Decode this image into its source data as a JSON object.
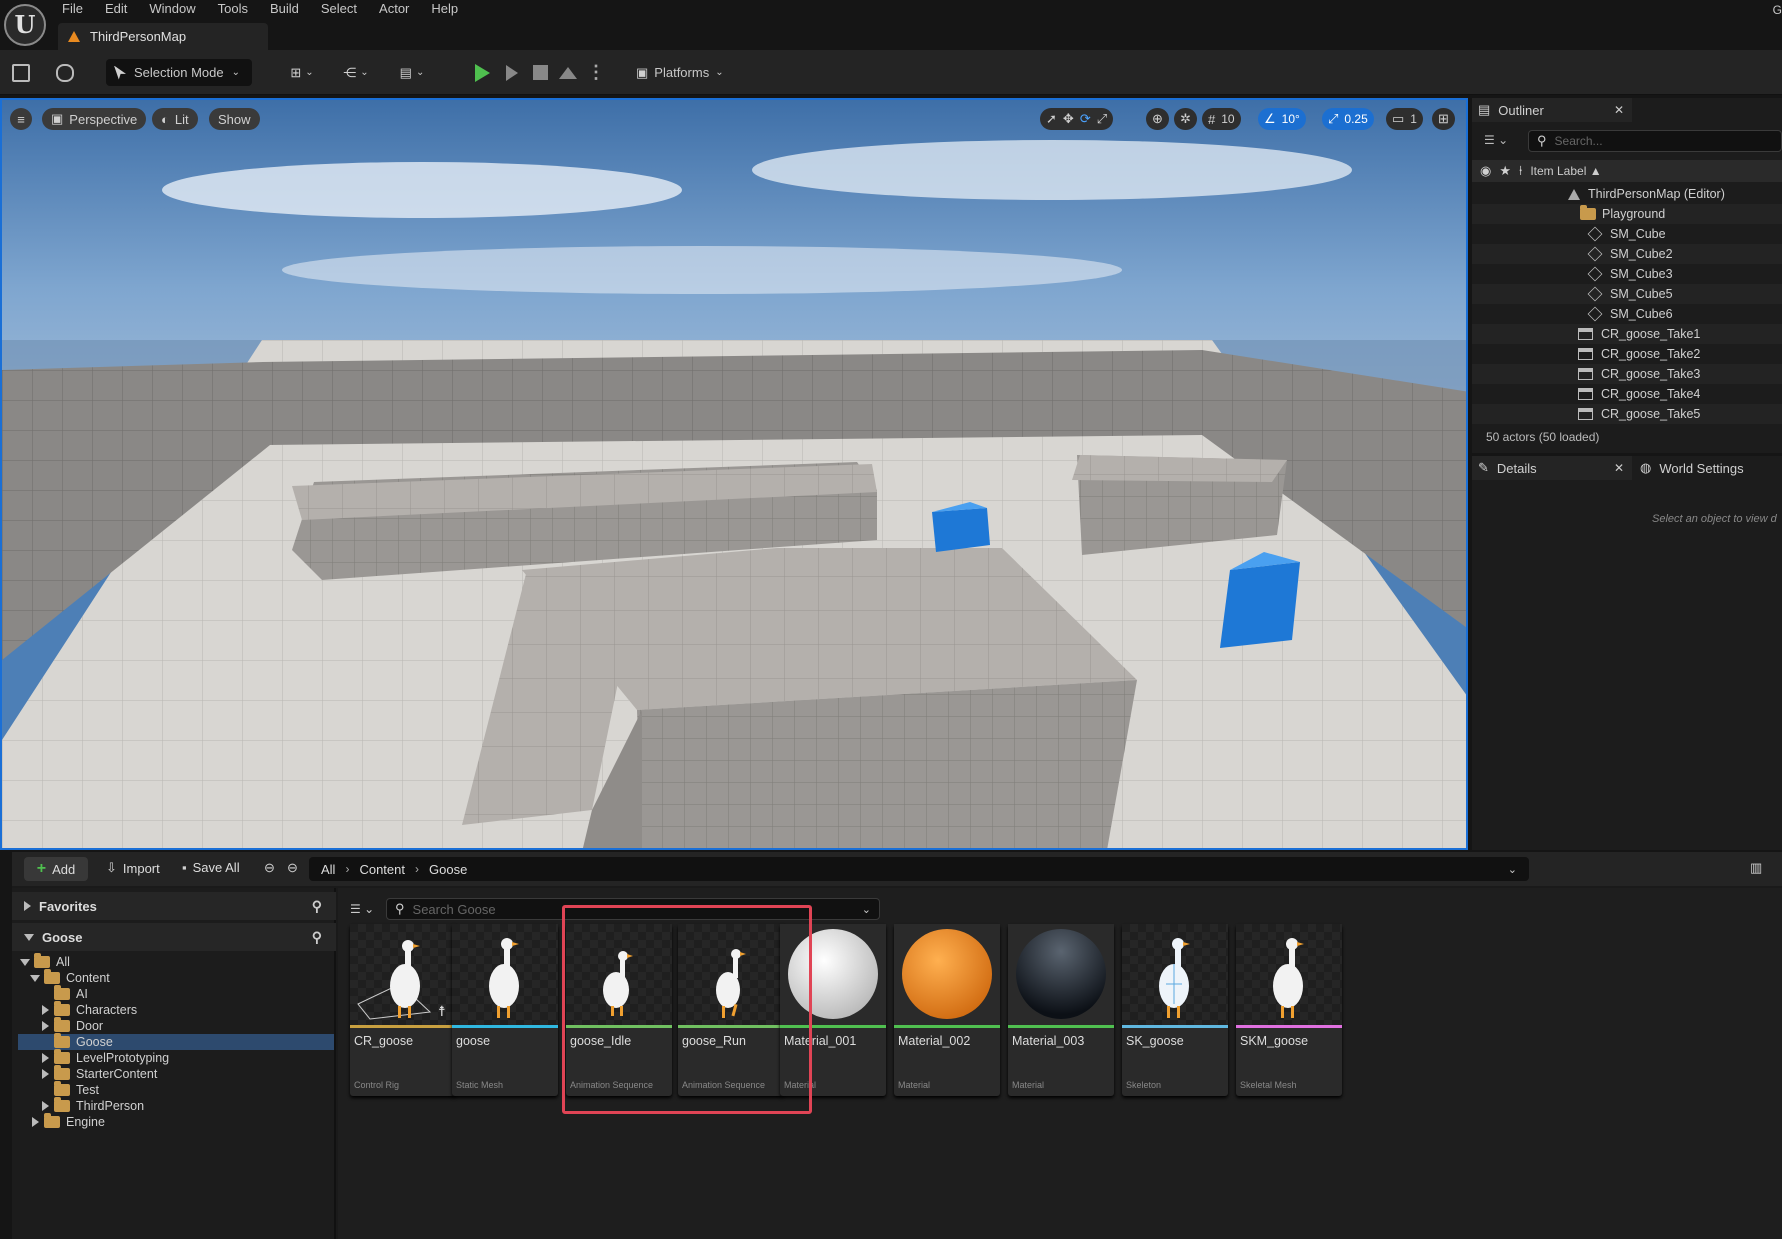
{
  "menubar": {
    "logo": "U",
    "items": [
      "File",
      "Edit",
      "Window",
      "Tools",
      "Build",
      "Select",
      "Actor",
      "Help"
    ],
    "doc_tab": "ThirdPersonMap",
    "corner": "G"
  },
  "toolbar": {
    "selection_mode": "Selection Mode",
    "platforms": "Platforms"
  },
  "viewport": {
    "perspective": "Perspective",
    "lit": "Lit",
    "show": "Show",
    "grid_snap": "10",
    "angle_snap": "10°",
    "scale_snap": "0.25",
    "camera_speed": "1",
    "colors": {
      "floor": "#d8d6d2",
      "wall": "#8a8886",
      "platform": "#b4b0ac",
      "cube": "#1e78d6",
      "sky_top": "#3e6fa8",
      "sky_bottom": "#b9cbe0"
    }
  },
  "outliner": {
    "title": "Outliner",
    "search_placeholder": "Search...",
    "column": "Item Label ▲",
    "rows": [
      {
        "label": "ThirdPersonMap (Editor)"
      },
      {
        "label": "Playground"
      },
      {
        "label": "SM_Cube"
      },
      {
        "label": "SM_Cube2"
      },
      {
        "label": "SM_Cube3"
      },
      {
        "label": "SM_Cube5"
      },
      {
        "label": "SM_Cube6"
      },
      {
        "label": "CR_goose_Take1"
      },
      {
        "label": "CR_goose_Take2"
      },
      {
        "label": "CR_goose_Take3"
      },
      {
        "label": "CR_goose_Take4"
      },
      {
        "label": "CR_goose_Take5"
      }
    ],
    "status": "50 actors (50 loaded)"
  },
  "details": {
    "title": "Details",
    "world_settings": "World Settings",
    "hint": "Select an object to view d"
  },
  "content_browser": {
    "add": "Add",
    "import": "Import",
    "save_all": "Save All",
    "breadcrumb": [
      "All",
      "Content",
      "Goose"
    ],
    "favorites": "Favorites",
    "goose_section": "Goose",
    "search_placeholder": "Search Goose",
    "folders": [
      {
        "label": "All"
      },
      {
        "label": "Content"
      },
      {
        "label": "AI"
      },
      {
        "label": "Characters"
      },
      {
        "label": "Door"
      },
      {
        "label": "Goose"
      },
      {
        "label": "LevelPrototyping"
      },
      {
        "label": "StarterContent"
      },
      {
        "label": "Test"
      },
      {
        "label": "ThirdPerson"
      },
      {
        "label": "Engine"
      }
    ],
    "assets": [
      {
        "name": "CR_goose",
        "type": "Control Rig",
        "color": "#c8a040"
      },
      {
        "name": "goose",
        "type": "Static Mesh",
        "color": "#30b8e0"
      },
      {
        "name": "goose_Idle",
        "type": "Animation Sequence",
        "color": "#70c060"
      },
      {
        "name": "goose_Run",
        "type": "Animation Sequence",
        "color": "#70c060"
      },
      {
        "name": "Material_001",
        "type": "Material",
        "color": "#50c050"
      },
      {
        "name": "Material_002",
        "type": "Material",
        "color": "#50c050"
      },
      {
        "name": "Material_003",
        "type": "Material",
        "color": "#50c050"
      },
      {
        "name": "SK_goose",
        "type": "Skeleton",
        "color": "#60b8e0"
      },
      {
        "name": "SKM_goose",
        "type": "Skeletal Mesh",
        "color": "#e070e0"
      }
    ]
  }
}
